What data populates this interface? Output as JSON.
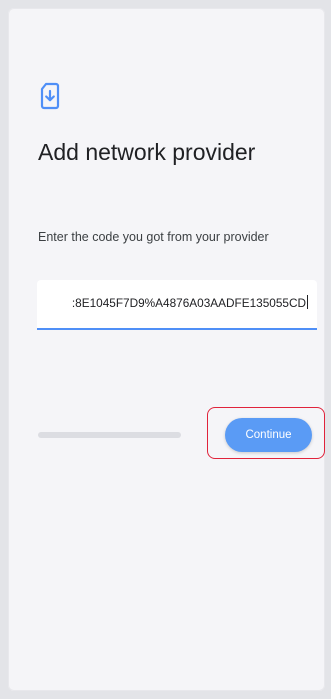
{
  "header": {
    "icon": "sim-download-icon",
    "title": "Add network provider",
    "subtitle": "Enter the code you got from your provider"
  },
  "code_field": {
    "value": ":8E1045F7D9%A4876A03AADFE135055CD"
  },
  "actions": {
    "continue_label": "Continue"
  },
  "colors": {
    "accent": "#4f8ff7",
    "button": "#5a9bf5",
    "highlight": "#e0233b",
    "background": "#f5f5f8"
  }
}
